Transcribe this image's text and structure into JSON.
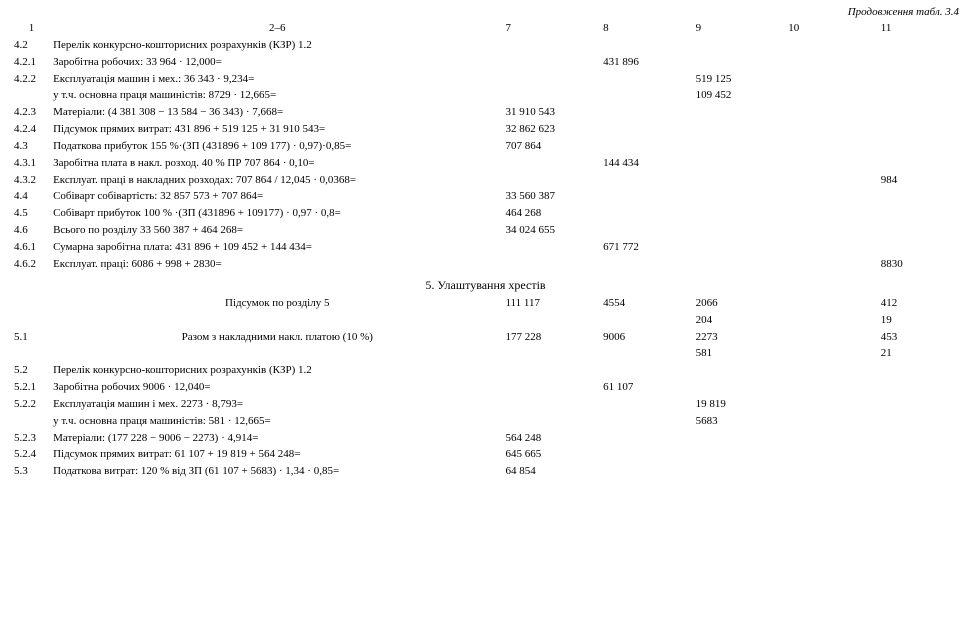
{
  "continuation": "Продовження табл. 3.4",
  "head": {
    "c1": "1",
    "c2": "2–6",
    "c7": "7",
    "c8": "8",
    "c9": "9",
    "c10": "10",
    "c11": "11"
  },
  "r": {
    "r1": {
      "c1": "4.2",
      "c2": "Перелік конкурсно-кошторисних розрахунків (КЗР) 1.2"
    },
    "r2": {
      "c1": "4.2.1",
      "c2": "Заробітна робочих: 33 964 · 12,000=",
      "c8": "431 896"
    },
    "r3": {
      "c1": "4.2.2",
      "c2": "Експлуатація машин і мех.: 36 343 · 9,234=",
      "c9": "519 125"
    },
    "r3b": {
      "c2": "у т.ч. основна праця машиністів: 8729 · 12,665=",
      "c9": "109 452"
    },
    "r4": {
      "c1": "4.2.3",
      "c2": "Матеріали: (4 381 308 − 13 584 − 36 343) · 7,668=",
      "c7": "31 910 543"
    },
    "r5": {
      "c1": "4.2.4",
      "c2": "Підсумок прямих витрат: 431 896 + 519 125 + 31 910 543=",
      "c7": "32 862 623"
    },
    "r6": {
      "c1": "4.3",
      "c2": "Податкова прибуток 155 %·(ЗП (431896 + 109 177) · 0,97)·0,85=",
      "c7": "707 864"
    },
    "r7": {
      "c1": "4.3.1",
      "c2": "Заробітна плата в накл. розход. 40 % ПР  707 864 · 0,10=",
      "c8": "144 434"
    },
    "r8": {
      "c1": "4.3.2",
      "c2": "Експлуат. праці в накладних розходах: 707 864 / 12,045 · 0,0368=",
      "c11": "984"
    },
    "r9": {
      "c1": "4.4",
      "c2": "Собіварт собівартість:   32 857 573 + 707 864=",
      "c7": "33 560 387"
    },
    "r10": {
      "c1": "4.5",
      "c2": "Собіварт прибуток  100 % ·(ЗП  (431896 + 109177) · 0,97 · 0,8=",
      "c7": "464 268"
    },
    "r11": {
      "c1": "4.6",
      "c2": "Всього по розділу  33 560 387 + 464 268=",
      "c7": "34 024 655"
    },
    "r12": {
      "c1": "4.6.1",
      "c2": "Сумарна заробітна плата: 431 896 + 109 452 + 144 434=",
      "c8": "671 772"
    },
    "r13": {
      "c1": "4.6.2",
      "c2": "Експлуат. праці: 6086 + 998 + 2830=",
      "c11": "8830"
    },
    "section2": "5. Улаштування хрестів",
    "r14": {
      "c2": "Підсумок по розділу 5",
      "c7": "111 117",
      "c8": "4554",
      "c9top": "2066",
      "c9bot": "204",
      "c11top": "412",
      "c11bot": "19"
    },
    "r15": {
      "c1": "5.1",
      "c2": "Разом з накладними накл. платою (10 %)",
      "c7": "177 228",
      "c8": "9006",
      "c9top": "2273",
      "c9bot": "581",
      "c11top": "453",
      "c11bot": "21"
    },
    "r16": {
      "c1": "5.2",
      "c2": "Перелік конкурсно-кошторисних розрахунків (КЗР) 1.2"
    },
    "r17": {
      "c1": "5.2.1",
      "c2": "Заробітна робочих  9006 · 12,040=",
      "c8": "61 107"
    },
    "r18": {
      "c1": "5.2.2",
      "c2": "Експлуатація машин і мех. 2273 · 8,793=",
      "c9": "19 819"
    },
    "r18b": {
      "c2": "у т.ч. основна праця машиністів: 581 · 12,665=",
      "c9": "5683"
    },
    "r19": {
      "c1": "5.2.3",
      "c2": "Матеріали: (177 228 − 9006 − 2273) · 4,914=",
      "c7": "564 248"
    },
    "r20": {
      "c1": "5.2.4",
      "c2": "Підсумок прямих витрат:  61 107 + 19 819 + 564 248=",
      "c7": "645 665"
    },
    "r21": {
      "c1": "5.3",
      "c2": "Податкова витрат: 120  % від ЗП  (61 107 + 5683) · 1,34 · 0,85=",
      "c7": "64 854"
    }
  }
}
